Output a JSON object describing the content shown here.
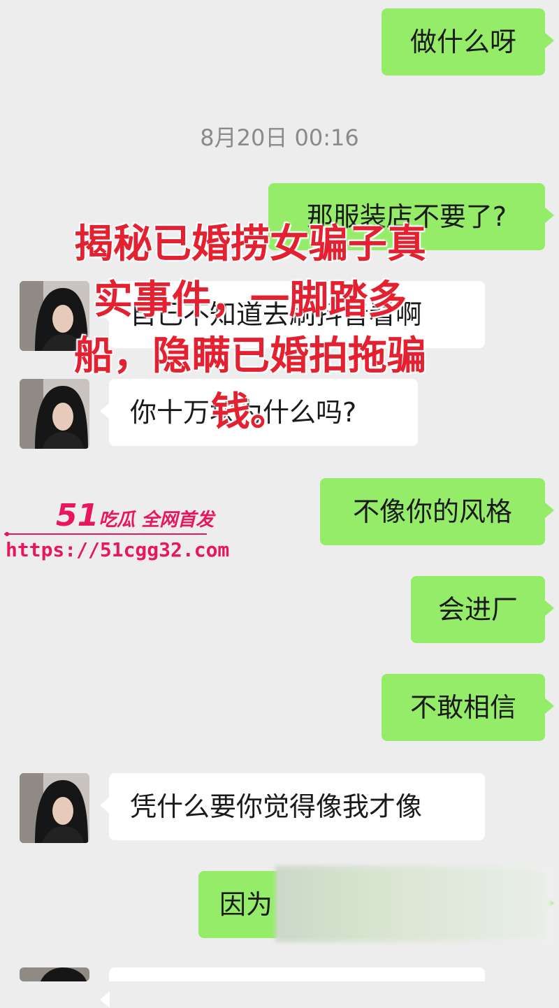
{
  "timestamp": "8月20日 00:16",
  "messages": {
    "m1": "做什么呀",
    "m2": "那服装店不要了?",
    "m3": "自己不知道去刷抖音看啊",
    "m4": "你十万块为什么吗?",
    "m5": "不像你的风格",
    "m6": "会进厂",
    "m7": "不敢相信",
    "m8": "凭什么要你觉得像我才像",
    "m9": "因为"
  },
  "overlay": {
    "line1": "揭秘已婚捞女骗子真",
    "line2": "实事件，一脚踏多",
    "line3": "船，隐瞒已婚拍拖骗",
    "line4": "钱。"
  },
  "watermark": {
    "brand_num": "51",
    "brand_text": "吃瓜 全网首发",
    "url": "https://51cgg32.com"
  },
  "colors": {
    "outgoing_bubble": "#95ec69",
    "incoming_bubble": "#ffffff",
    "background": "#ededed",
    "overlay_text": "#e32130",
    "watermark": "#e8175d"
  }
}
